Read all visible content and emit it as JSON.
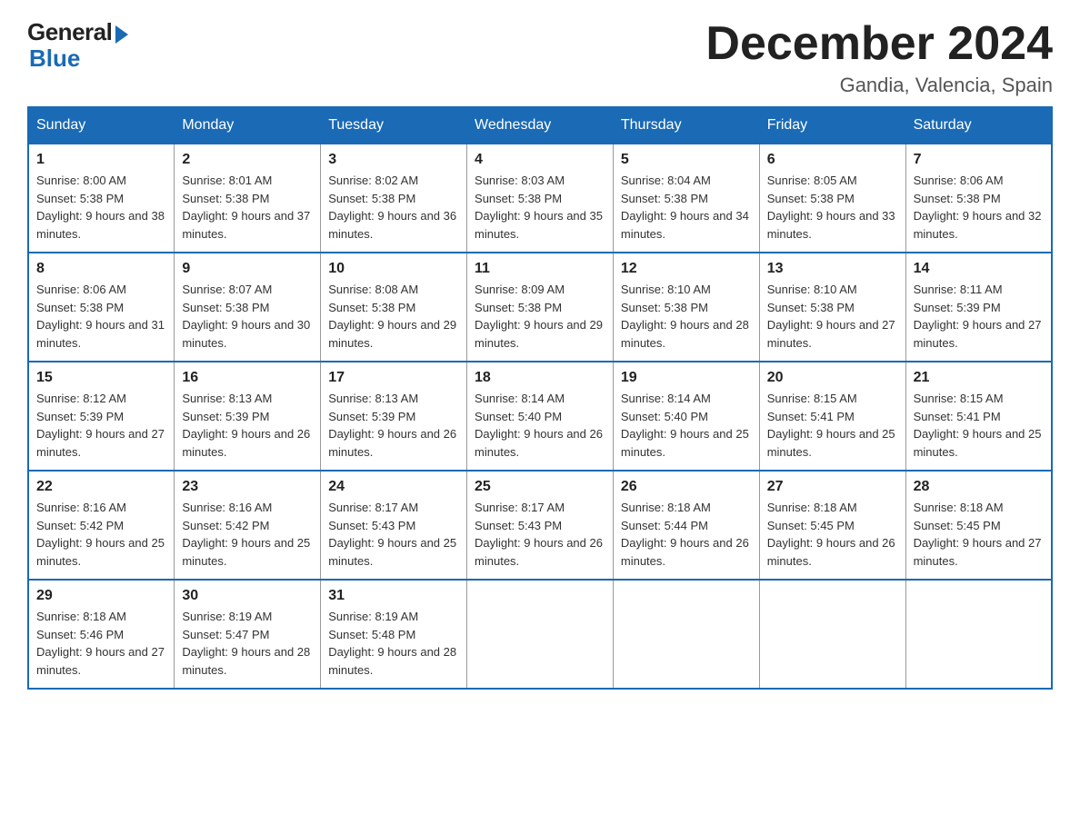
{
  "header": {
    "logo_general": "General",
    "logo_blue": "Blue",
    "month_title": "December 2024",
    "location": "Gandia, Valencia, Spain"
  },
  "days_of_week": [
    "Sunday",
    "Monday",
    "Tuesday",
    "Wednesday",
    "Thursday",
    "Friday",
    "Saturday"
  ],
  "weeks": [
    [
      {
        "day": "1",
        "sunrise": "8:00 AM",
        "sunset": "5:38 PM",
        "daylight": "9 hours and 38 minutes."
      },
      {
        "day": "2",
        "sunrise": "8:01 AM",
        "sunset": "5:38 PM",
        "daylight": "9 hours and 37 minutes."
      },
      {
        "day": "3",
        "sunrise": "8:02 AM",
        "sunset": "5:38 PM",
        "daylight": "9 hours and 36 minutes."
      },
      {
        "day": "4",
        "sunrise": "8:03 AM",
        "sunset": "5:38 PM",
        "daylight": "9 hours and 35 minutes."
      },
      {
        "day": "5",
        "sunrise": "8:04 AM",
        "sunset": "5:38 PM",
        "daylight": "9 hours and 34 minutes."
      },
      {
        "day": "6",
        "sunrise": "8:05 AM",
        "sunset": "5:38 PM",
        "daylight": "9 hours and 33 minutes."
      },
      {
        "day": "7",
        "sunrise": "8:06 AM",
        "sunset": "5:38 PM",
        "daylight": "9 hours and 32 minutes."
      }
    ],
    [
      {
        "day": "8",
        "sunrise": "8:06 AM",
        "sunset": "5:38 PM",
        "daylight": "9 hours and 31 minutes."
      },
      {
        "day": "9",
        "sunrise": "8:07 AM",
        "sunset": "5:38 PM",
        "daylight": "9 hours and 30 minutes."
      },
      {
        "day": "10",
        "sunrise": "8:08 AM",
        "sunset": "5:38 PM",
        "daylight": "9 hours and 29 minutes."
      },
      {
        "day": "11",
        "sunrise": "8:09 AM",
        "sunset": "5:38 PM",
        "daylight": "9 hours and 29 minutes."
      },
      {
        "day": "12",
        "sunrise": "8:10 AM",
        "sunset": "5:38 PM",
        "daylight": "9 hours and 28 minutes."
      },
      {
        "day": "13",
        "sunrise": "8:10 AM",
        "sunset": "5:38 PM",
        "daylight": "9 hours and 27 minutes."
      },
      {
        "day": "14",
        "sunrise": "8:11 AM",
        "sunset": "5:39 PM",
        "daylight": "9 hours and 27 minutes."
      }
    ],
    [
      {
        "day": "15",
        "sunrise": "8:12 AM",
        "sunset": "5:39 PM",
        "daylight": "9 hours and 27 minutes."
      },
      {
        "day": "16",
        "sunrise": "8:13 AM",
        "sunset": "5:39 PM",
        "daylight": "9 hours and 26 minutes."
      },
      {
        "day": "17",
        "sunrise": "8:13 AM",
        "sunset": "5:39 PM",
        "daylight": "9 hours and 26 minutes."
      },
      {
        "day": "18",
        "sunrise": "8:14 AM",
        "sunset": "5:40 PM",
        "daylight": "9 hours and 26 minutes."
      },
      {
        "day": "19",
        "sunrise": "8:14 AM",
        "sunset": "5:40 PM",
        "daylight": "9 hours and 25 minutes."
      },
      {
        "day": "20",
        "sunrise": "8:15 AM",
        "sunset": "5:41 PM",
        "daylight": "9 hours and 25 minutes."
      },
      {
        "day": "21",
        "sunrise": "8:15 AM",
        "sunset": "5:41 PM",
        "daylight": "9 hours and 25 minutes."
      }
    ],
    [
      {
        "day": "22",
        "sunrise": "8:16 AM",
        "sunset": "5:42 PM",
        "daylight": "9 hours and 25 minutes."
      },
      {
        "day": "23",
        "sunrise": "8:16 AM",
        "sunset": "5:42 PM",
        "daylight": "9 hours and 25 minutes."
      },
      {
        "day": "24",
        "sunrise": "8:17 AM",
        "sunset": "5:43 PM",
        "daylight": "9 hours and 25 minutes."
      },
      {
        "day": "25",
        "sunrise": "8:17 AM",
        "sunset": "5:43 PM",
        "daylight": "9 hours and 26 minutes."
      },
      {
        "day": "26",
        "sunrise": "8:18 AM",
        "sunset": "5:44 PM",
        "daylight": "9 hours and 26 minutes."
      },
      {
        "day": "27",
        "sunrise": "8:18 AM",
        "sunset": "5:45 PM",
        "daylight": "9 hours and 26 minutes."
      },
      {
        "day": "28",
        "sunrise": "8:18 AM",
        "sunset": "5:45 PM",
        "daylight": "9 hours and 27 minutes."
      }
    ],
    [
      {
        "day": "29",
        "sunrise": "8:18 AM",
        "sunset": "5:46 PM",
        "daylight": "9 hours and 27 minutes."
      },
      {
        "day": "30",
        "sunrise": "8:19 AM",
        "sunset": "5:47 PM",
        "daylight": "9 hours and 28 minutes."
      },
      {
        "day": "31",
        "sunrise": "8:19 AM",
        "sunset": "5:48 PM",
        "daylight": "9 hours and 28 minutes."
      },
      null,
      null,
      null,
      null
    ]
  ]
}
